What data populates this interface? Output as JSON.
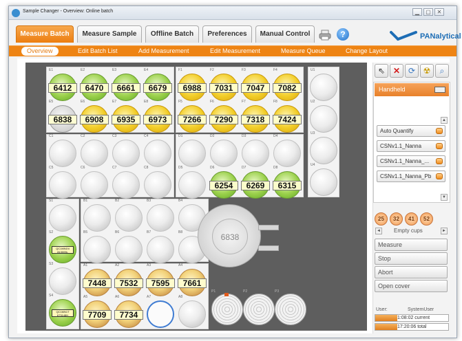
{
  "window": {
    "title": "Sample Changer - Overview: Online batch"
  },
  "tabs": [
    "Measure Batch",
    "Measure Sample",
    "Offline Batch",
    "Preferences",
    "Manual Control"
  ],
  "help_label": "?",
  "brand": "PANalytical",
  "subnav": [
    "Overview",
    "Edit Batch List",
    "Add Measurement",
    "Edit Measurement",
    "Measure Queue",
    "Change Layout"
  ],
  "colors": {
    "accent": "#ee8414",
    "brand": "#1d6db5",
    "loaded_green": "#9ad04a",
    "loaded_yellow": "#f2cd27",
    "selection_ring": "#3f7cd2"
  },
  "racks": {
    "E": {
      "labels": [
        "E1",
        "E2",
        "E3",
        "E4",
        "E5",
        "E6",
        "E7",
        "E8"
      ],
      "values": [
        "6412",
        "6470",
        "6661",
        "6679",
        "6838",
        "6908",
        "6935",
        "6973"
      ],
      "states": [
        "green",
        "green",
        "green",
        "green",
        "gray",
        "yellow",
        "yellow",
        "yellow"
      ]
    },
    "F": {
      "labels": [
        "F1",
        "F2",
        "F3",
        "F4",
        "F5",
        "F6",
        "F7",
        "F8"
      ],
      "values": [
        "6988",
        "7031",
        "7047",
        "7082",
        "7266",
        "7290",
        "7318",
        "7424"
      ],
      "states": [
        "yellow",
        "yellow",
        "yellow",
        "yellow",
        "yellow",
        "yellow",
        "yellow",
        "yellow"
      ]
    },
    "C": {
      "labels": [
        "C1",
        "C2",
        "C3",
        "C4",
        "C5",
        "C6",
        "C7",
        "C8"
      ],
      "values": [
        "",
        "",
        "",
        "",
        "",
        "",
        "",
        ""
      ],
      "states": [
        "empty",
        "empty",
        "empty",
        "empty",
        "empty",
        "empty",
        "empty",
        "empty"
      ]
    },
    "D": {
      "labels": [
        "D1",
        "D2",
        "D3",
        "D4",
        "D5",
        "D6",
        "D7",
        "D8"
      ],
      "values": [
        "",
        "",
        "",
        "",
        "",
        "6254",
        "6269",
        "6315"
      ],
      "states": [
        "empty",
        "empty",
        "empty",
        "empty",
        "empty",
        "green",
        "green",
        "green"
      ]
    },
    "B": {
      "labels": [
        "B1",
        "B2",
        "B3",
        "B4",
        "B5",
        "B6",
        "B7",
        "B8"
      ],
      "values": [
        "",
        "",
        "",
        "",
        "",
        "",
        "",
        ""
      ],
      "states": [
        "empty",
        "empty",
        "empty",
        "empty",
        "empty",
        "empty",
        "empty",
        "empty"
      ]
    },
    "A": {
      "labels": [
        "A1",
        "A2",
        "A3",
        "A4",
        "A5",
        "A6",
        "A7",
        "A8"
      ],
      "values": [
        "7448",
        "7532",
        "7595",
        "7661",
        "7709",
        "7734",
        "",
        ""
      ],
      "states": [
        "orange",
        "orange",
        "orange",
        "orange",
        "orange",
        "orange",
        "ring",
        "empty"
      ]
    }
  },
  "u_labels": [
    "U1",
    "U2",
    "U3",
    "U4"
  ],
  "s_labels": [
    "S1",
    "S2",
    "S3",
    "S4"
  ],
  "s_barcodes": {
    "S2": "QC1MN1N 813005L",
    "S4": "QC1MN1T 673148H"
  },
  "p_labels": [
    "P1",
    "P2",
    "P3"
  ],
  "changer_value": "6838",
  "toolbar_icons": [
    "pointer-icon",
    "delete-icon",
    "refresh-icon",
    "radiation-icon",
    "search-icon"
  ],
  "sidebar": {
    "handheld": "Handheld",
    "items": [
      "Auto Quantify",
      "CSNv1.1_Nanna",
      "CSNv1.1_Nanna_...",
      "CSNv1.1_Nanna_Pb"
    ],
    "scroll_up": "▲",
    "scroll_down": "▼"
  },
  "empty_cups": {
    "label": "Empty cups",
    "sizes": [
      "25",
      "32",
      "41",
      "52"
    ],
    "prev": "◄",
    "next": "►"
  },
  "actions": [
    "Measure",
    "Stop",
    "Abort",
    "Open cover"
  ],
  "status": {
    "user_label": "User:",
    "user": "SystemUser",
    "current": "1:08:02 current",
    "total": "17:20:06 total",
    "current_progress": 0.3,
    "total_progress": 0.3
  }
}
